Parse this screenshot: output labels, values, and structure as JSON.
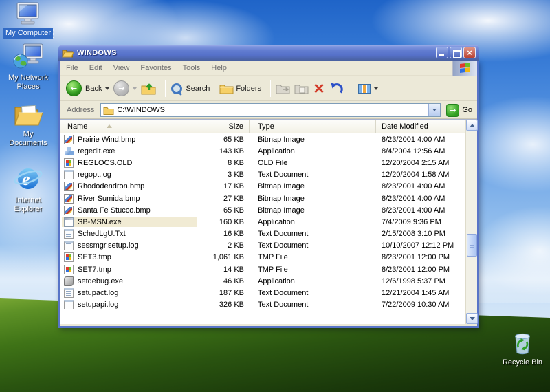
{
  "desktop": {
    "icons": [
      {
        "label": "My Computer",
        "selected": true
      },
      {
        "label": "My Network Places",
        "selected": false
      },
      {
        "label": "My Documents",
        "selected": false
      },
      {
        "label": "Internet Explorer",
        "selected": false
      },
      {
        "label": "Recycle Bin",
        "selected": false
      }
    ]
  },
  "window": {
    "title": "WINDOWS",
    "controls": {
      "close_glyph": "×"
    },
    "menu": [
      "File",
      "Edit",
      "View",
      "Favorites",
      "Tools",
      "Help"
    ],
    "toolbar": {
      "back_label": "Back",
      "back_glyph": "←",
      "forward_glyph": "→",
      "search_label": "Search",
      "folders_label": "Folders"
    },
    "address": {
      "label": "Address",
      "value": "C:\\WINDOWS",
      "go_label": "Go",
      "go_glyph": "→"
    },
    "columns": {
      "name": "Name",
      "size": "Size",
      "type": "Type",
      "date": "Date Modified"
    },
    "files": [
      {
        "name": "Prairie Wind.bmp",
        "size": "65 KB",
        "type": "Bitmap Image",
        "date": "8/23/2001 4:00 AM",
        "icon": "bmp",
        "highlighted": false
      },
      {
        "name": "regedit.exe",
        "size": "143 KB",
        "type": "Application",
        "date": "8/4/2004 12:56 AM",
        "icon": "regedit",
        "highlighted": false
      },
      {
        "name": "REGLOCS.OLD",
        "size": "8 KB",
        "type": "OLD File",
        "date": "12/20/2004 2:15 AM",
        "icon": "generic",
        "highlighted": false
      },
      {
        "name": "regopt.log",
        "size": "3 KB",
        "type": "Text Document",
        "date": "12/20/2004 1:58 AM",
        "icon": "text",
        "highlighted": false
      },
      {
        "name": "Rhododendron.bmp",
        "size": "17 KB",
        "type": "Bitmap Image",
        "date": "8/23/2001 4:00 AM",
        "icon": "bmp",
        "highlighted": false
      },
      {
        "name": "River Sumida.bmp",
        "size": "27 KB",
        "type": "Bitmap Image",
        "date": "8/23/2001 4:00 AM",
        "icon": "bmp",
        "highlighted": false
      },
      {
        "name": "Santa Fe Stucco.bmp",
        "size": "65 KB",
        "type": "Bitmap Image",
        "date": "8/23/2001 4:00 AM",
        "icon": "bmp",
        "highlighted": false
      },
      {
        "name": "SB-MSN.exe",
        "size": "160 KB",
        "type": "Application",
        "date": "7/4/2009 9:36 PM",
        "icon": "appwindow",
        "highlighted": true
      },
      {
        "name": "SchedLgU.Txt",
        "size": "16 KB",
        "type": "Text Document",
        "date": "2/15/2008 3:10 PM",
        "icon": "text",
        "highlighted": false
      },
      {
        "name": "sessmgr.setup.log",
        "size": "2 KB",
        "type": "Text Document",
        "date": "10/10/2007 12:12 PM",
        "icon": "text",
        "highlighted": false
      },
      {
        "name": "SET3.tmp",
        "size": "1,061 KB",
        "type": "TMP File",
        "date": "8/23/2001 12:00 PM",
        "icon": "generic",
        "highlighted": false
      },
      {
        "name": "SET7.tmp",
        "size": "14 KB",
        "type": "TMP File",
        "date": "8/23/2001 12:00 PM",
        "icon": "generic",
        "highlighted": false
      },
      {
        "name": "setdebug.exe",
        "size": "46 KB",
        "type": "Application",
        "date": "12/6/1998 5:37 PM",
        "icon": "debug",
        "highlighted": false
      },
      {
        "name": "setupact.log",
        "size": "187 KB",
        "type": "Text Document",
        "date": "12/21/2004 1:45 AM",
        "icon": "text",
        "highlighted": false
      },
      {
        "name": "setupapi.log",
        "size": "326 KB",
        "type": "Text Document",
        "date": "7/22/2009 10:30 AM",
        "icon": "text",
        "highlighted": false
      }
    ]
  },
  "colors": {
    "titlebar_blue": "#5874c8",
    "selection_blue": "#316ac5",
    "toolbar_bg": "#ece9d8",
    "row_highlight": "#f1ebd4",
    "go_green": "#37a428",
    "delete_red": "#d23a28"
  }
}
